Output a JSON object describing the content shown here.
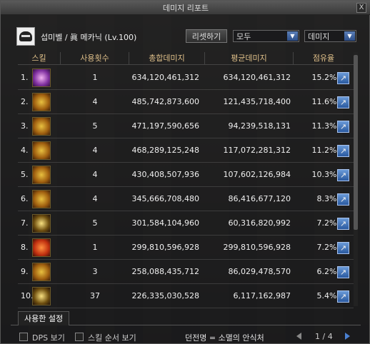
{
  "window": {
    "title": "데미지 리포트",
    "close_label": "X"
  },
  "character": {
    "name": "섭미벨 / 眞 메카닉 (Lv.100)"
  },
  "toolbar": {
    "reset_label": "리셋하기",
    "filter_select": "모두",
    "sort_select": "데미지"
  },
  "table": {
    "headers": [
      "스킬",
      "사용횟수",
      "총합데미지",
      "평균데미지",
      "점유율"
    ],
    "percent_sign": "%",
    "rows": [
      {
        "rank": "1.",
        "icon": "purple",
        "count": "1",
        "total": "634,120,461,312",
        "avg": "634,120,461,312",
        "share": "15.2"
      },
      {
        "rank": "2.",
        "icon": "gold",
        "count": "4",
        "total": "485,742,873,600",
        "avg": "121,435,718,400",
        "share": "11.6"
      },
      {
        "rank": "3.",
        "icon": "gold",
        "count": "5",
        "total": "471,197,590,656",
        "avg": "94,239,518,131",
        "share": "11.3"
      },
      {
        "rank": "4.",
        "icon": "gold",
        "count": "4",
        "total": "468,289,125,248",
        "avg": "117,072,281,312",
        "share": "11.2"
      },
      {
        "rank": "5.",
        "icon": "gold",
        "count": "4",
        "total": "430,408,507,936",
        "avg": "107,602,126,984",
        "share": "10.3"
      },
      {
        "rank": "6.",
        "icon": "gold",
        "count": "4",
        "total": "345,666,708,480",
        "avg": "86,416,677,120",
        "share": "8.3"
      },
      {
        "rank": "7.",
        "icon": "dark",
        "count": "5",
        "total": "301,584,104,960",
        "avg": "60,316,820,992",
        "share": "7.2"
      },
      {
        "rank": "8.",
        "icon": "red",
        "count": "1",
        "total": "299,810,596,928",
        "avg": "299,810,596,928",
        "share": "7.2"
      },
      {
        "rank": "9.",
        "icon": "gold",
        "count": "3",
        "total": "258,088,435,712",
        "avg": "86,029,478,570",
        "share": "6.2"
      },
      {
        "rank": "10.",
        "icon": "dark",
        "count": "37",
        "total": "226,335,030,528",
        "avg": "6,117,162,987",
        "share": "5.4"
      }
    ]
  },
  "tabs": {
    "settings_label": "사용한 설정"
  },
  "footer": {
    "dps_label": "DPS 보기",
    "skill_order_label": "스킬 순서 보기",
    "dungeon_label": "던전명 = 소멸의 안식처",
    "page_label": "1 / 4"
  },
  "colors": {
    "header_text": "#e0c08a",
    "accent_blue": "#4a80d0"
  }
}
